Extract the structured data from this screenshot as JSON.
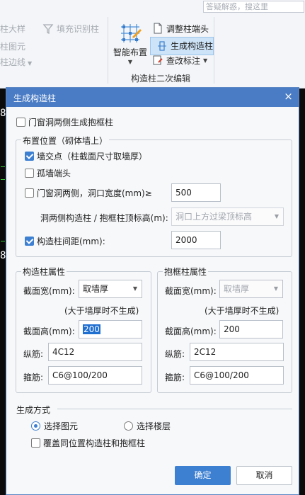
{
  "ribbon": {
    "search_placeholder": "答疑解惑，搜这里",
    "left_items": [
      "柱大样",
      "柱图元",
      "柱边线"
    ],
    "fill_identify": "填充识别柱",
    "smart_layout": "智能布置",
    "adjust_column_end": "调整柱端头",
    "generate_construction_column": "生成构造柱",
    "check_annotation": "查改标注",
    "group_label": "构造柱二次编辑"
  },
  "canvas": {
    "edge_numbers": [
      "8",
      "8"
    ]
  },
  "dialog": {
    "title": "生成构造柱",
    "close_glyph": "×",
    "generate_frame_columns": {
      "label": "门窗洞两侧生成抱框柱",
      "checked": false
    },
    "placement": {
      "legend": "布置位置（砌体墙上）",
      "wall_intersection": {
        "label": "墙交点（柱截面尺寸取墙厚）",
        "checked": true
      },
      "isolated_wall_end": {
        "label": "孤墙端头",
        "checked": false
      },
      "opening_sides": {
        "label": "门窗洞两侧，洞口宽度(mm)≥",
        "checked": false,
        "value": "500"
      },
      "top_elevation": {
        "label": "洞两侧构造柱 / 抱框柱顶标高(m):",
        "value": "洞口上方过梁顶标高"
      },
      "spacing": {
        "label": "构造柱间距(mm):",
        "checked": true,
        "value": "2000"
      }
    },
    "construction_column": {
      "legend": "构造柱属性",
      "section_width_label": "截面宽(mm):",
      "section_width_value": "取墙厚",
      "note": "(大于墙厚时不生成)",
      "section_height_label": "截面高(mm):",
      "section_height_value": "200",
      "longitudinal_label": "纵筋:",
      "longitudinal_value": "4C12",
      "stirrup_label": "箍筋:",
      "stirrup_value": "C6@100/200"
    },
    "frame_column": {
      "legend": "抱框柱属性",
      "section_width_label": "截面宽(mm):",
      "section_width_value": "取墙厚",
      "note": "(大于墙厚时不生成)",
      "section_height_label": "截面高(mm):",
      "section_height_value": "200",
      "longitudinal_label": "纵筋:",
      "longitudinal_value": "2C12",
      "stirrup_label": "箍筋:",
      "stirrup_value": "C6@100/200"
    },
    "mode": {
      "legend": "生成方式",
      "select_elements": {
        "label": "选择图元",
        "selected": true
      },
      "select_floors": {
        "label": "选择楼层",
        "selected": false
      },
      "overwrite": {
        "label": "覆盖同位置构造柱和抱框柱",
        "checked": false
      }
    },
    "ok_label": "确定",
    "cancel_label": "取消"
  },
  "colors": {
    "accent": "#3d7fd1",
    "titlebar": "#4a7cc5"
  }
}
